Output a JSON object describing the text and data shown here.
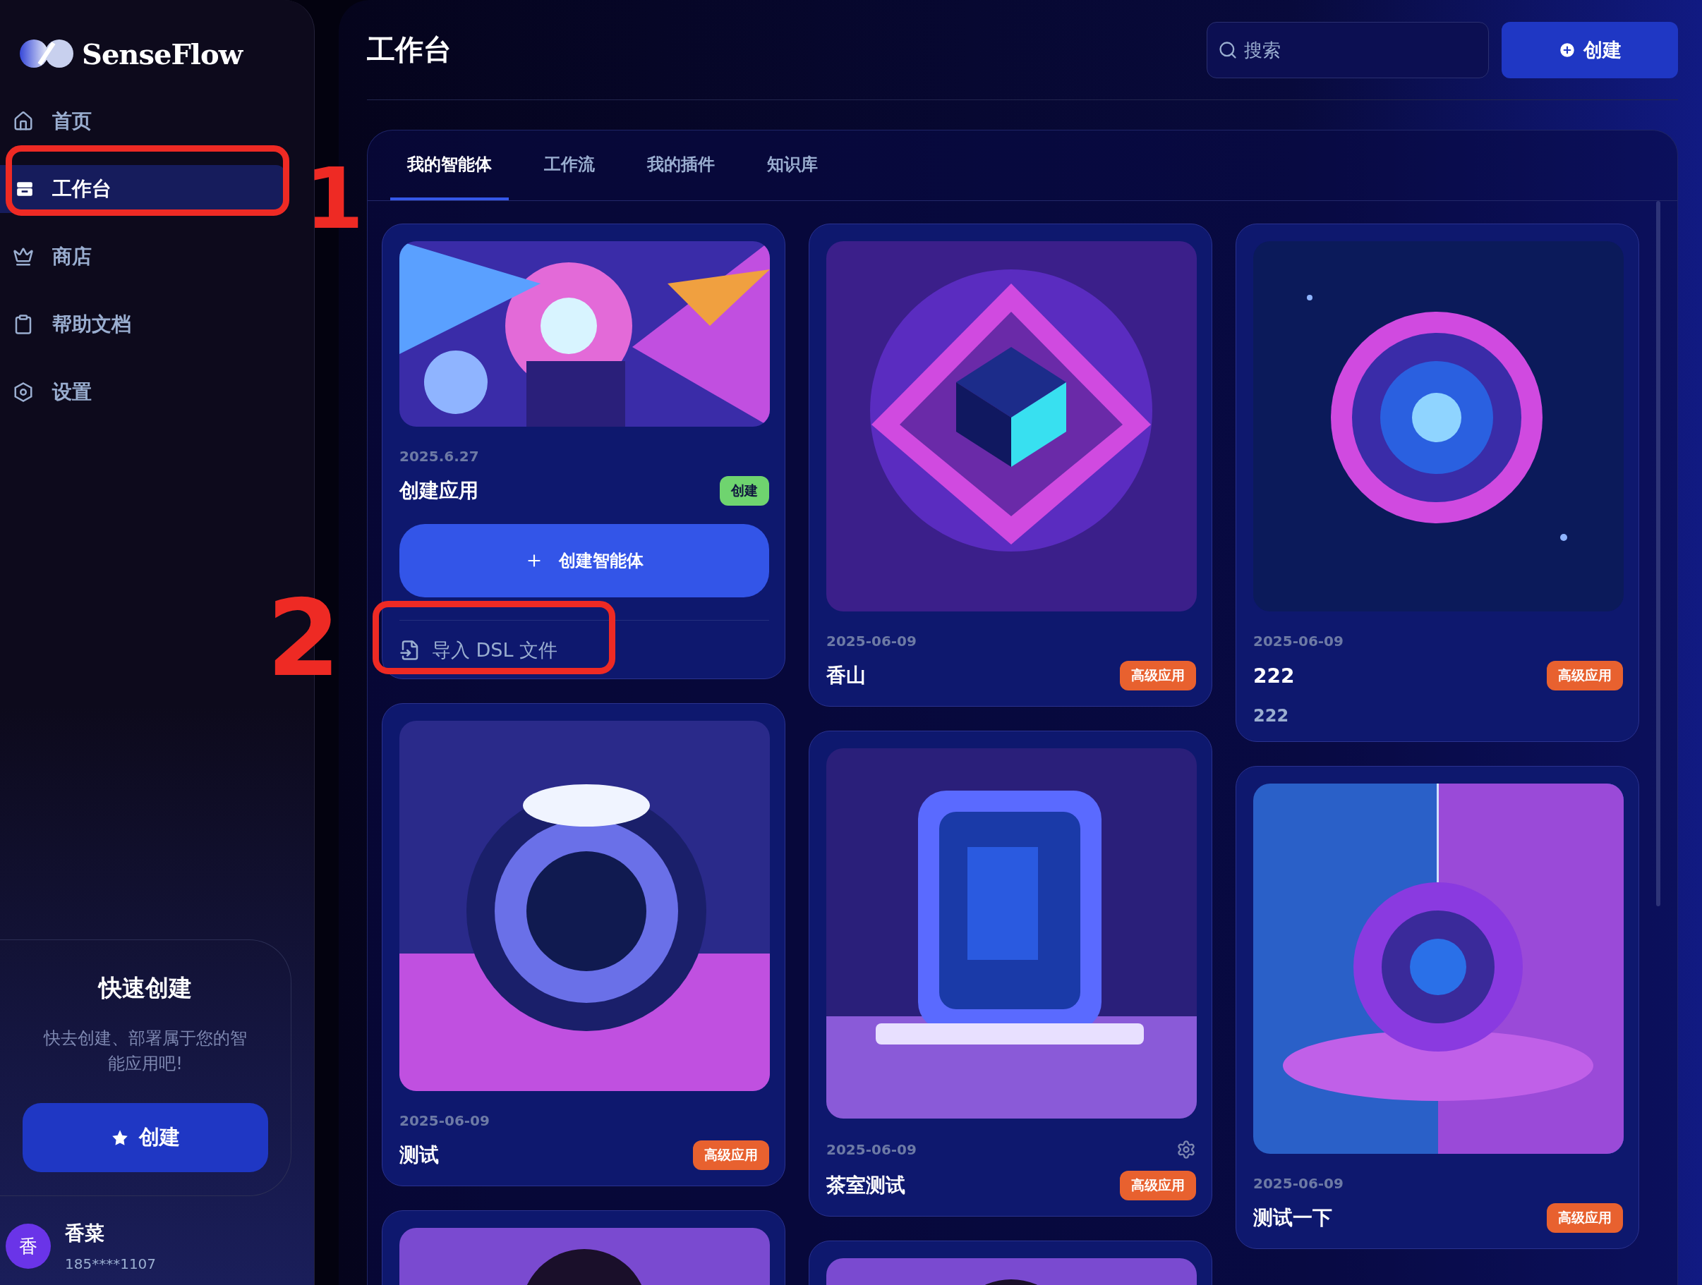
{
  "sidebar": {
    "logo": "SenseFlow",
    "items": [
      {
        "label": "首页",
        "selected": false
      },
      {
        "label": "工作台",
        "selected": true
      },
      {
        "label": "商店",
        "selected": false
      },
      {
        "label": "帮助文档",
        "selected": false
      },
      {
        "label": "设置",
        "selected": false
      }
    ],
    "quick_create": {
      "title": "快速创建",
      "text": "快去创建、部署属于您的智能应用吧!",
      "button": "创建"
    },
    "user": {
      "avatar": "香",
      "name": "香菜",
      "phone": "185****1107"
    }
  },
  "header": {
    "title": "工作台",
    "search": {
      "placeholder": "搜索"
    },
    "create_button": "创建"
  },
  "tabs": [
    {
      "label": "我的智能体",
      "selected": true
    },
    {
      "label": "工作流",
      "selected": false
    },
    {
      "label": "我的插件",
      "selected": false
    },
    {
      "label": "知识库",
      "selected": false
    }
  ],
  "columns": [
    [
      {
        "kind": "create",
        "date": "2025.6.27",
        "name": "创建应用",
        "badge": "创建",
        "button": "创建智能体",
        "import_link": "导入 DSL 文件"
      },
      {
        "kind": "app",
        "date": "2025-06-09",
        "name": "测试",
        "badge": "高级应用"
      },
      {
        "kind": "partial"
      }
    ],
    [
      {
        "kind": "app",
        "date": "2025-06-09",
        "name": "香山",
        "badge": "高级应用"
      },
      {
        "kind": "app",
        "date": "2025-06-09",
        "name": "茶室测试",
        "badge": "高级应用",
        "settings": true
      },
      {
        "kind": "partial"
      }
    ],
    [
      {
        "kind": "app",
        "date": "2025-06-09",
        "name": "222",
        "badge": "高级应用",
        "description": "222"
      },
      {
        "kind": "app",
        "date": "2025-06-09",
        "name": "测试一下",
        "badge": "高级应用"
      }
    ]
  ],
  "annotations": [
    {
      "kind": "box"
    },
    {
      "kind": "number",
      "label": "1"
    },
    {
      "kind": "number",
      "label": "2"
    },
    {
      "kind": "box"
    }
  ]
}
